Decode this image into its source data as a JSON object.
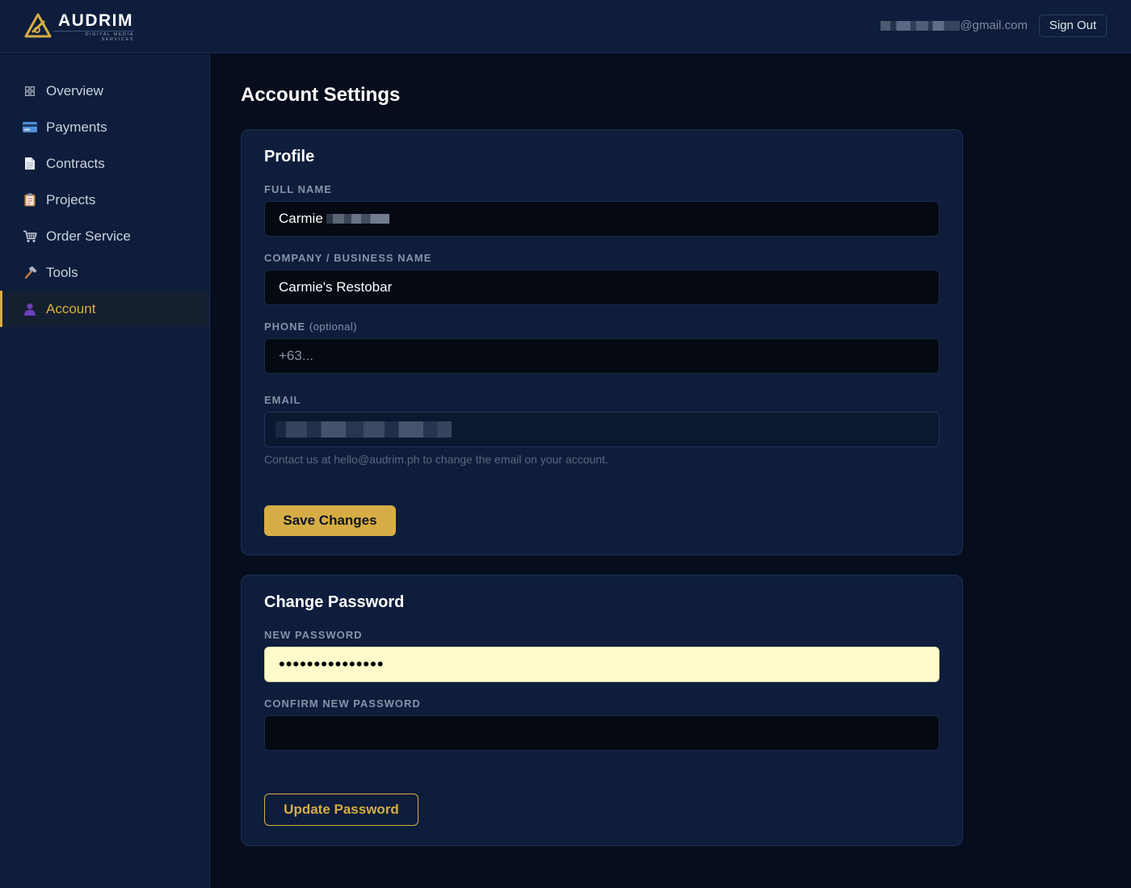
{
  "brand": {
    "name": "AUDRIM",
    "tagline": "DIGITAL MEDIA SERVICES",
    "accent_color": "#d6ad45"
  },
  "header": {
    "user_email_suffix": "@gmail.com",
    "sign_out_label": "Sign Out"
  },
  "sidebar": {
    "items": [
      {
        "label": "Overview",
        "icon": "grid-icon",
        "active": false
      },
      {
        "label": "Payments",
        "icon": "credit-card-icon",
        "active": false
      },
      {
        "label": "Contracts",
        "icon": "document-icon",
        "active": false
      },
      {
        "label": "Projects",
        "icon": "clipboard-icon",
        "active": false
      },
      {
        "label": "Order Service",
        "icon": "cart-icon",
        "active": false
      },
      {
        "label": "Tools",
        "icon": "hammer-icon",
        "active": false
      },
      {
        "label": "Account",
        "icon": "user-icon",
        "active": true
      }
    ]
  },
  "page": {
    "title": "Account Settings"
  },
  "profile": {
    "title": "Profile",
    "full_name_label": "FULL NAME",
    "full_name_value": "Carmie",
    "company_label": "COMPANY / BUSINESS NAME",
    "company_value": "Carmie's Restobar",
    "phone_label": "PHONE",
    "phone_optional": "(optional)",
    "phone_placeholder": "+63...",
    "email_label": "EMAIL",
    "email_hint": "Contact us at hello@audrim.ph to change the email on your account.",
    "save_label": "Save Changes"
  },
  "password": {
    "title": "Change Password",
    "new_label": "NEW PASSWORD",
    "new_value": "•••••••••••••••",
    "confirm_label": "CONFIRM NEW PASSWORD",
    "confirm_value": "",
    "update_label": "Update Password"
  }
}
